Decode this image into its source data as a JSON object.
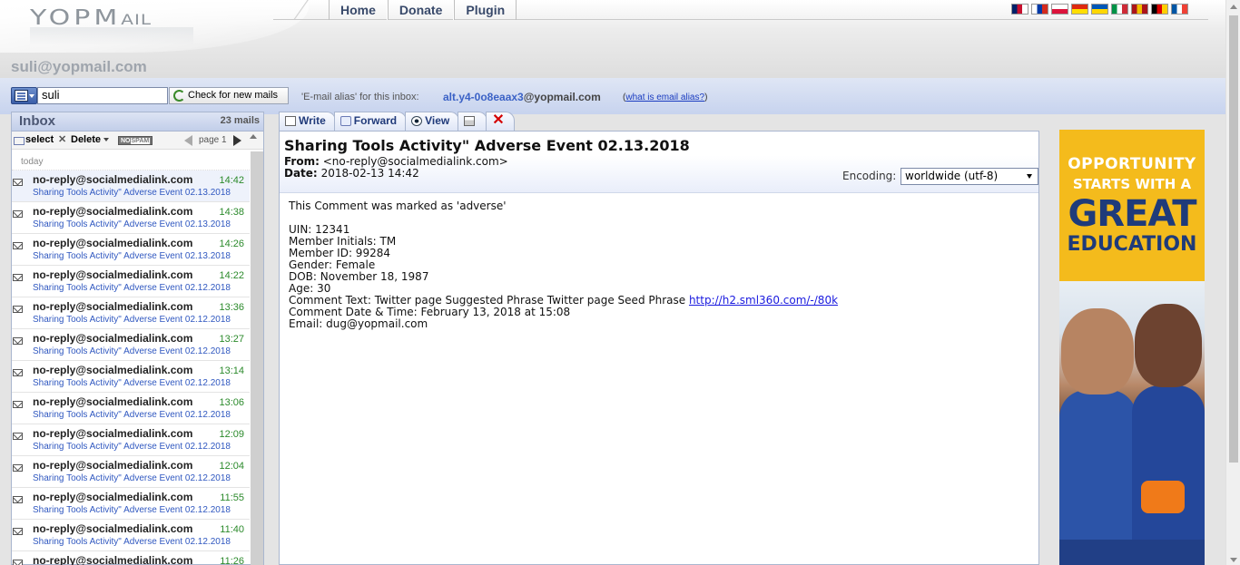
{
  "header": {
    "logo_main": "YOPM",
    "logo_tail": "AIL",
    "mailbox_address": "suli@yopmail.com"
  },
  "nav": {
    "items": [
      "Home",
      "Donate",
      "Plugin"
    ]
  },
  "flags": [
    {
      "name": "uk-flag-icon",
      "colors": [
        "#012169",
        "#c8102e",
        "#ffffff"
      ]
    },
    {
      "name": "russia-flag-icon",
      "colors": [
        "#ffffff",
        "#0039a6",
        "#d52b1e"
      ]
    },
    {
      "name": "poland-flag-icon",
      "colors": [
        "#ffffff",
        "#dc143c"
      ]
    },
    {
      "name": "china-flag-icon",
      "colors": [
        "#de2910",
        "#ffde00"
      ]
    },
    {
      "name": "ukraine-flag-icon",
      "colors": [
        "#0057b7",
        "#ffd700"
      ]
    },
    {
      "name": "italy-flag-icon",
      "colors": [
        "#009246",
        "#ffffff",
        "#ce2b37"
      ]
    },
    {
      "name": "spain-flag-icon",
      "colors": [
        "#aa151b",
        "#f1bf00",
        "#aa151b"
      ]
    },
    {
      "name": "germany-flag-icon",
      "colors": [
        "#000000",
        "#dd0000",
        "#ffce00"
      ]
    },
    {
      "name": "france-flag-icon",
      "colors": [
        "#0055a4",
        "#ffffff",
        "#ef4135"
      ]
    }
  ],
  "toolbar": {
    "login_value": "suli",
    "check_label": "Check for new mails",
    "alias_text": "'E-mail alias' for this inbox:",
    "alias_local": "alt.y4-0o8eaax3",
    "alias_domain": "@yopmail.com",
    "alias_help_open": "(",
    "alias_help_link": "what is email alias?",
    "alias_help_close": ")"
  },
  "inbox": {
    "title": "Inbox",
    "count": "23 mails",
    "select_label": "select",
    "delete_label": "Delete",
    "nospam_no": "NO",
    "nospam_spam": "SPAM",
    "page_label": "page 1",
    "day_label": "today",
    "mails": [
      {
        "from": "no-reply@socialmedialink.com",
        "time": "14:42",
        "subject": "Sharing Tools Activity\" Adverse Event 02.13.2018"
      },
      {
        "from": "no-reply@socialmedialink.com",
        "time": "14:38",
        "subject": "Sharing Tools Activity\" Adverse Event 02.13.2018"
      },
      {
        "from": "no-reply@socialmedialink.com",
        "time": "14:26",
        "subject": "Sharing Tools Activity\" Adverse Event 02.13.2018"
      },
      {
        "from": "no-reply@socialmedialink.com",
        "time": "14:22",
        "subject": "Sharing Tools Activity\" Adverse Event 02.12.2018"
      },
      {
        "from": "no-reply@socialmedialink.com",
        "time": "13:36",
        "subject": "Sharing Tools Activity\" Adverse Event 02.12.2018"
      },
      {
        "from": "no-reply@socialmedialink.com",
        "time": "13:27",
        "subject": "Sharing Tools Activity\" Adverse Event 02.12.2018"
      },
      {
        "from": "no-reply@socialmedialink.com",
        "time": "13:14",
        "subject": "Sharing Tools Activity\" Adverse Event 02.12.2018"
      },
      {
        "from": "no-reply@socialmedialink.com",
        "time": "13:06",
        "subject": "Sharing Tools Activity\" Adverse Event 02.12.2018"
      },
      {
        "from": "no-reply@socialmedialink.com",
        "time": "12:09",
        "subject": "Sharing Tools Activity\" Adverse Event 02.12.2018"
      },
      {
        "from": "no-reply@socialmedialink.com",
        "time": "12:04",
        "subject": "Sharing Tools Activity\" Adverse Event 02.12.2018"
      },
      {
        "from": "no-reply@socialmedialink.com",
        "time": "11:55",
        "subject": "Sharing Tools Activity\" Adverse Event 02.12.2018"
      },
      {
        "from": "no-reply@socialmedialink.com",
        "time": "11:40",
        "subject": "Sharing Tools Activity\" Adverse Event 02.12.2018"
      },
      {
        "from": "no-reply@socialmedialink.com",
        "time": "11:26",
        "subject": "Sharing Tools Activity\" Adverse Event 02.12.2018"
      }
    ]
  },
  "message_tabs": {
    "write": "Write",
    "forward": "Forward",
    "view": "View"
  },
  "message": {
    "subject": "Sharing Tools Activity\" Adverse Event 02.13.2018",
    "from_label": "From:",
    "from_value": "<no-reply@socialmedialink.com>",
    "date_label": "Date:",
    "date_value": "2018-02-13 14:42",
    "encoding_label": "Encoding:",
    "encoding_value": "worldwide (utf-8)",
    "body_lines": [
      "This Comment was marked as 'adverse'",
      "",
      "UIN: 12341",
      "Member Initials: TM",
      "Member ID: 99284",
      "Gender: Female",
      "DOB: November 18, 1987",
      "Age: 30"
    ],
    "comment_text_prefix": "Comment Text: Twitter page Suggested Phrase Twitter page Seed Phrase ",
    "comment_link": "http://h2.sml360.com/-/80k",
    "body_tail_lines": [
      "Comment Date & Time: February 13, 2018 at 15:08",
      "Email: dug@yopmail.com"
    ]
  },
  "ad": {
    "line1": "OPPORTUNITY",
    "line2": "STARTS WITH A",
    "line3": "GREAT",
    "line4": "EDUCATION",
    "colors": {
      "top": "#f4bb1c",
      "text_blue": "#1f3b7a"
    }
  }
}
